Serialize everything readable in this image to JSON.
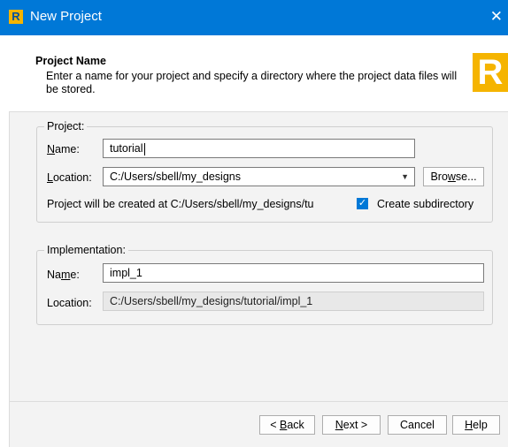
{
  "window": {
    "title": "New Project",
    "app_icon_glyph": "R",
    "close_glyph": "✕"
  },
  "header": {
    "title": "Project Name",
    "description": "Enter a name for your project and specify a directory where the project data files will be stored.",
    "logo_glyph": "R"
  },
  "project": {
    "legend": "Project:",
    "name_label_u": "N",
    "name_label_rest": "ame:",
    "name_value": "tutorial",
    "location_label_u": "L",
    "location_label_rest": "ocation:",
    "location_value": "C:/Users/sbell/my_designs",
    "browse_label_pre": "Bro",
    "browse_label_u": "w",
    "browse_label_post": "se...",
    "created_at_text": "Project will be created at C:/Users/sbell/my_designs/tu",
    "create_subdirectory_label": "Create subdirectory",
    "create_subdirectory_checked": true
  },
  "implementation": {
    "legend": "Implementation:",
    "name_label_pre": "Na",
    "name_label_u": "m",
    "name_label_post": "e:",
    "name_value": "impl_1",
    "location_label": "Location:",
    "location_value": "C:/Users/sbell/my_designs/tutorial/impl_1"
  },
  "footer": {
    "back_pre": "< ",
    "back_u": "B",
    "back_post": "ack",
    "next_u": "N",
    "next_post": "ext >",
    "cancel": "Cancel",
    "help_u": "H",
    "help_post": "elp"
  },
  "colors": {
    "titlebar": "#0078d7",
    "accent": "#f5b400",
    "panel": "#f3f3f3"
  }
}
